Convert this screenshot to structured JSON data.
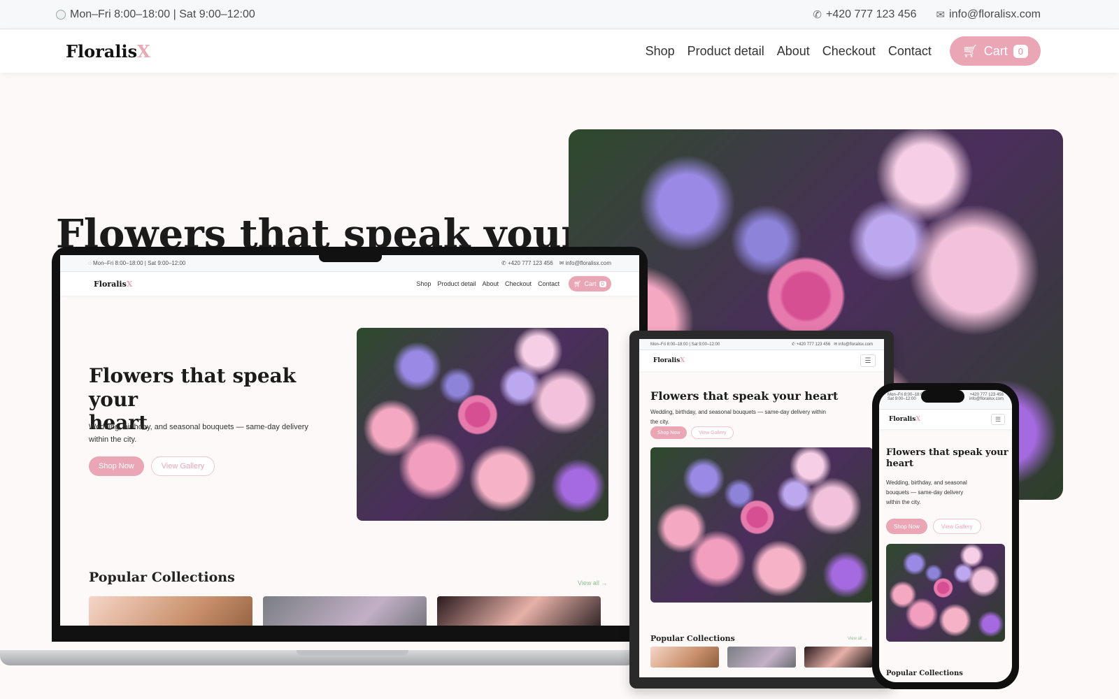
{
  "topbar": {
    "hours": "Mon–Fri 8:00–18:00 | Sat 9:00–12:00",
    "phone": "+420 777 123 456",
    "email": "info@floralisx.com"
  },
  "brand": {
    "name": "Floralis",
    "accent": "X"
  },
  "nav": {
    "items": [
      "Shop",
      "Product detail",
      "About",
      "Checkout",
      "Contact"
    ],
    "cart_label": "Cart",
    "cart_count": "0"
  },
  "hero": {
    "title": "Flowers that speak your heart",
    "title_visible": "Flowers that speak your",
    "title_line1": "Flowers that speak your",
    "title_line2": "heart",
    "subtitle": "Wedding, birthday, and seasonal bouquets — same-day delivery within the city.",
    "subtitle_laptop_l1": "Wedding, birthday, and seasonal bouquets — same-day delivery",
    "subtitle_laptop_l2": "within the city.",
    "subtitle_tablet_l1": "Wedding, birthday, and seasonal bouquets — same-day delivery within",
    "subtitle_tablet_l2": "the city.",
    "subtitle_phone_l1": "Wedding, birthday, and seasonal",
    "subtitle_phone_l2": "bouquets — same-day delivery",
    "subtitle_phone_l3": "within the city.",
    "primary_button": "Shop Now",
    "secondary_button": "View Gallery"
  },
  "collections": {
    "title": "Popular Collections",
    "view_all": "View all →"
  },
  "phone_topbar": {
    "hours_l1": "Mon–Fri 8:00–18:00",
    "hours_l2": "Sat 9:00–12:00",
    "phone": "+420 777 123 456",
    "email": "info@floralisx.com"
  },
  "colors": {
    "accent": "#eaa6b5",
    "brand_x": "#e7a9b6",
    "background": "#fcf9f8"
  }
}
